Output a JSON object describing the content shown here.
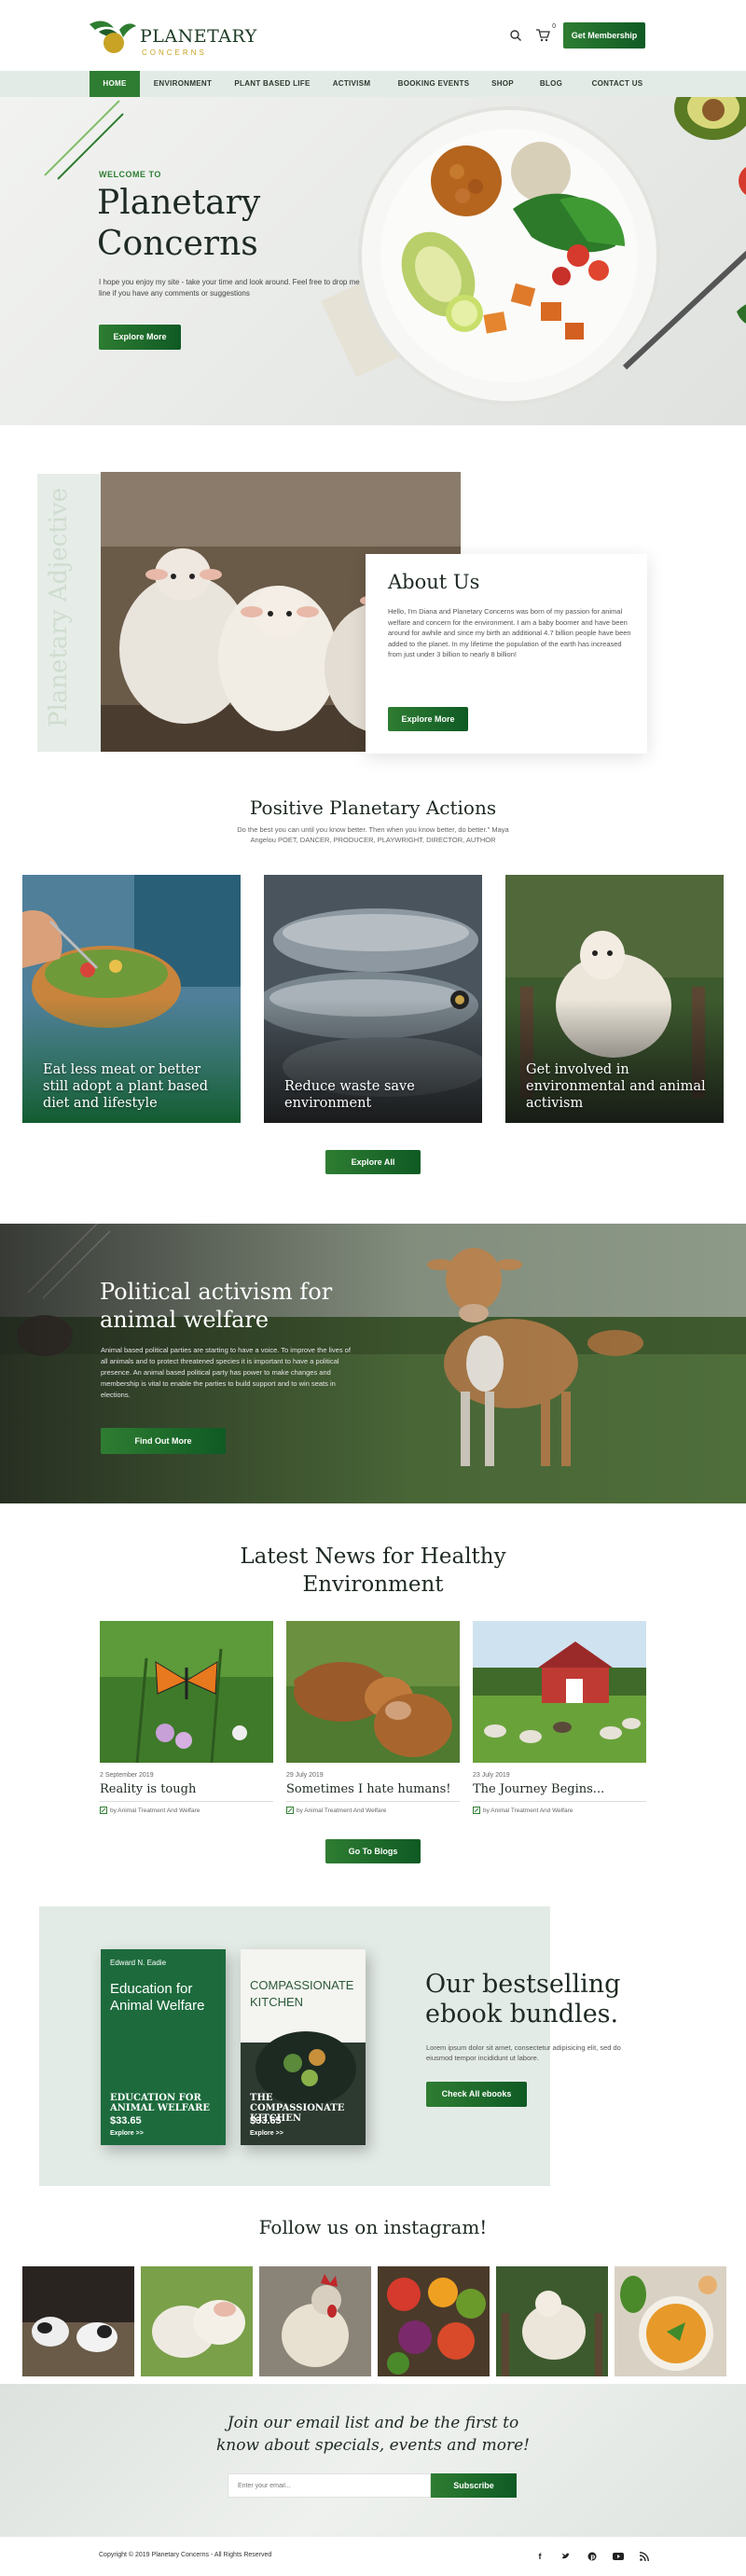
{
  "brand": {
    "title": "PLANETARY",
    "subtitle": "CONCERNS"
  },
  "header": {
    "cart_count": "0",
    "membership_label": "Get Membership",
    "search_icon": "search-icon",
    "cart_icon": "cart-icon"
  },
  "nav": [
    "HOME",
    "ENVIRONMENT",
    "PLANT BASED LIFE",
    "ACTIVISM",
    "BOOKING EVENTS",
    "SHOP",
    "BLOG",
    "CONTACT US"
  ],
  "hero": {
    "kicker": "WELCOME TO",
    "title": "Planetary Concerns",
    "text": "I hope you enjoy my site - take your time and look around. Feel free to drop me a line if you have any comments or suggestions",
    "button": "Explore More"
  },
  "about": {
    "vertical_text": "Planetary Adjective",
    "title": "About Us",
    "text": "Hello, I'm Diana and Planetary Concerns was born of my passion for animal welfare and concern for the environment. I am a baby boomer and have been around for awhile and since my birth an additional 4.7 billion people have been added to the planet. In my lifetime the population of the earth has increased from just under 3 billion to nearly 8 billion!",
    "button": "Explore More"
  },
  "actions": {
    "title": "Positive Planetary Actions",
    "quote": "Do the best you can until you know better. Then when you know better, do better.\" Maya Angelou POET, DANCER, PRODUCER, PLAYWRIGHT, DIRECTOR, AUTHOR",
    "cards": [
      {
        "label": "Eat less meat or better still adopt a plant based diet and lifestyle"
      },
      {
        "label": "Reduce waste save environment"
      },
      {
        "label": "Get involved in environmental and animal activism"
      }
    ],
    "button": "Explore All"
  },
  "activism": {
    "title": "Political activism for animal welfare",
    "text": "Animal based political parties are starting to have a voice. To improve the lives of all animals and to protect threatened species it is important to have a political presence. An animal based political party has power to make changes and membership is vital to enable the parties to build support and to win seats in elections.",
    "button": "Find Out More"
  },
  "news": {
    "title_line1": "Latest News for Healthy",
    "title_line2": "Environment",
    "items": [
      {
        "date": "2 September 2019",
        "title": "Reality is tough",
        "author": "by Animal Treatment And Welfare"
      },
      {
        "date": "29 July 2019",
        "title": "Sometimes I hate humans!",
        "author": "by Animal Treatment And Welfare"
      },
      {
        "date": "23 July 2019",
        "title": "The Journey Begins...",
        "author": "by Animal Treatment And Welfare"
      }
    ],
    "button": "Go To Blogs"
  },
  "ebooks": {
    "books": [
      {
        "author": "Edward N. Eadie",
        "cover_title": "Education for Animal Welfare",
        "name": "EDUCATION FOR ANIMAL WELFARE",
        "price": "$33.65",
        "link": "Explore >>"
      },
      {
        "author": "",
        "cover_title": "COMPASSIONATE KITCHEN",
        "name": "THE COMPASSIONATE KITCHEN",
        "price": "$33.65",
        "link": "Explore >>"
      }
    ],
    "title": "Our bestselling ebook bundles.",
    "text": "Lorem ipsum dolor sit amet, consectetur adipisicing elit, sed do eiusmod tempor incididunt ut labore.",
    "button": "Check All ebooks"
  },
  "instagram": {
    "title": "Follow us on instagram!"
  },
  "newsletter": {
    "title": "Join our email list and be the first to know about specials, events and more!",
    "placeholder": "Enter your email...",
    "button": "Subscribe"
  },
  "footer": {
    "copyright": "Copyright © 2019 Planetary Concerns - All Rights Reserved",
    "social": [
      "facebook-icon",
      "twitter-icon",
      "pinterest-icon",
      "youtube-icon",
      "rss-icon"
    ]
  },
  "colors": {
    "accent": "#2e7d32",
    "accent_dark": "#0f5a24",
    "nav_bg": "#e3ebe6",
    "panel_bg": "#e3ebe6",
    "gold": "#c8a324"
  }
}
